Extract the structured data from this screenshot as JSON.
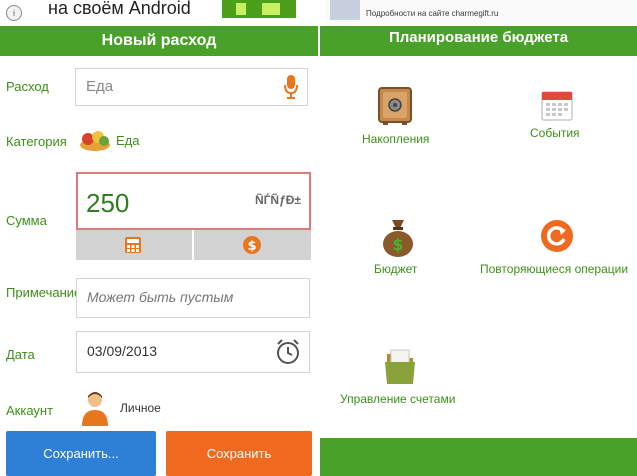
{
  "ad": {
    "left_text": "на своём Android",
    "right_line1": "Подробности на сайте charmegift.ru",
    "info_glyph": "i"
  },
  "left": {
    "title": "Новый расход",
    "expense": {
      "label": "Расход",
      "value": "Еда",
      "icon": "microphone-icon"
    },
    "category": {
      "label": "Категория",
      "value": "Еда",
      "icon": "food-icon"
    },
    "sum": {
      "label": "Сумма",
      "value": "250",
      "currency": "ÑЃÑƒÐ±"
    },
    "note": {
      "label": "Примечание",
      "placeholder": "Может быть пустым"
    },
    "date": {
      "label": "Дата",
      "value": "03/09/2013",
      "icon": "alarm-clock-icon"
    },
    "account": {
      "label": "Аккаунт",
      "value": "Личное",
      "icon": "user-avatar-icon"
    },
    "buttons": {
      "save_more": "Сохранить...",
      "save": "Сохранить"
    },
    "colors": {
      "accent": "#4aa12a",
      "blue": "#2e7fd6",
      "orange": "#ef6a1f"
    }
  },
  "right": {
    "title": "Планирование бюджета",
    "tiles": [
      {
        "label": "Накопления",
        "icon": "safe-icon"
      },
      {
        "label": "События",
        "icon": "calendar-icon"
      },
      {
        "label": "Бюджет",
        "icon": "money-bag-icon"
      },
      {
        "label": "Повторяющиеся операции",
        "icon": "repeat-icon"
      },
      {
        "label": "Управление счетами",
        "icon": "folder-icon"
      }
    ]
  }
}
